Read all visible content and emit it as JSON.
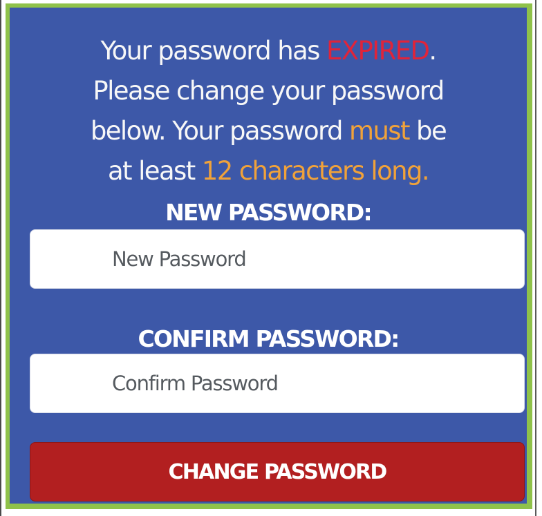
{
  "message": {
    "line1_prefix": "Your password has ",
    "expired_word": "EXPIRED",
    "line1_suffix": ".",
    "line2": "Please change your password",
    "line3_prefix": "below. Your password ",
    "must_word": "must",
    "line3_suffix": " be",
    "line4_prefix": "at least ",
    "length_phrase": "12 characters long."
  },
  "form": {
    "new_password": {
      "label": "NEW PASSWORD:",
      "value": "",
      "placeholder": "New Password"
    },
    "confirm_password": {
      "label": "CONFIRM PASSWORD:",
      "value": "",
      "placeholder": "Confirm Password"
    },
    "submit_label": "CHANGE PASSWORD"
  },
  "colors": {
    "panel_background": "#3d58a8",
    "panel_border": "#8fc24a",
    "expired_text": "#e0243a",
    "highlight_text": "#f0a23a",
    "button_background": "#b21f20"
  }
}
